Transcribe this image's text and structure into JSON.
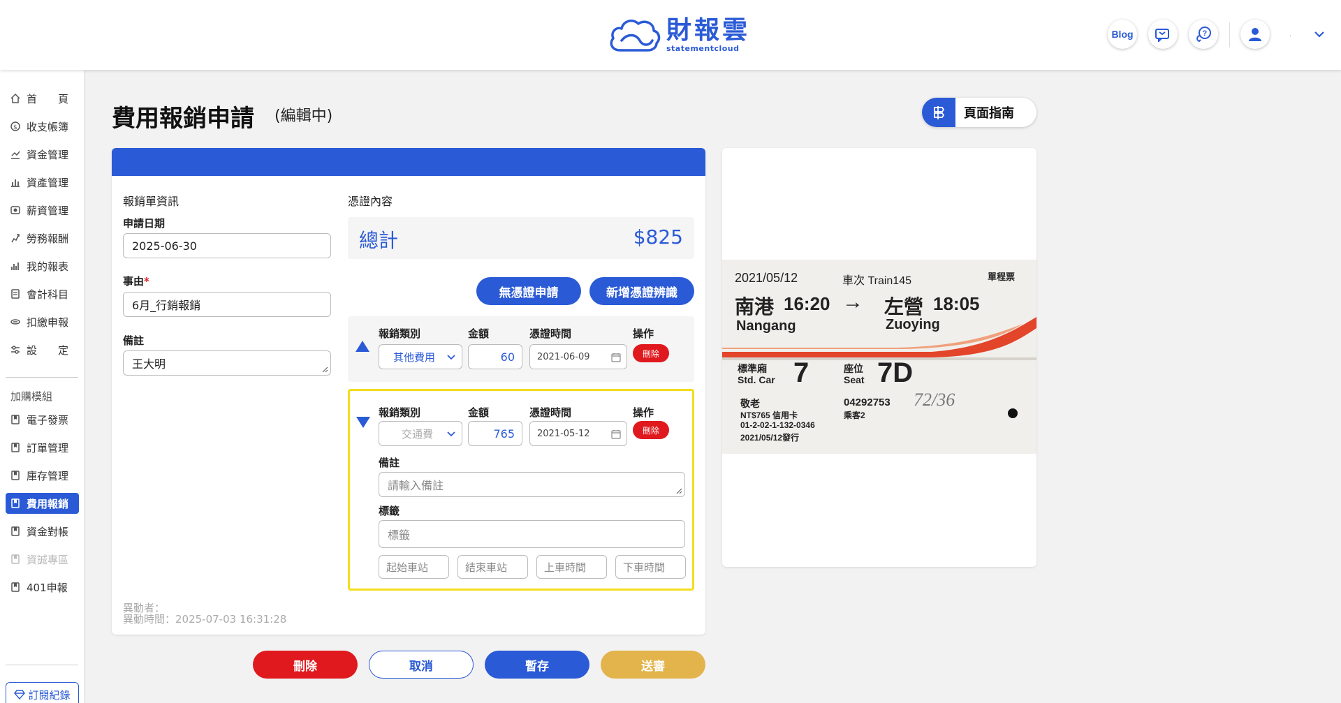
{
  "app": {
    "brand_name": "財報雲",
    "brand_sub": "statementcloud",
    "blog_label": "Blog",
    "user_dot": "·"
  },
  "sidebar": {
    "items": [
      {
        "label": "首　　頁",
        "icon": "home-icon"
      },
      {
        "label": "收支帳簿",
        "icon": "coin-icon"
      },
      {
        "label": "資金管理",
        "icon": "funds-icon"
      },
      {
        "label": "資產管理",
        "icon": "assets-icon"
      },
      {
        "label": "薪資管理",
        "icon": "payroll-icon"
      },
      {
        "label": "勞務報酬",
        "icon": "labor-icon"
      },
      {
        "label": "我的報表",
        "icon": "report-icon"
      },
      {
        "label": "會計科目",
        "icon": "ledger-icon"
      },
      {
        "label": "扣繳申報",
        "icon": "tax-icon"
      },
      {
        "label": "設　　定",
        "icon": "settings-icon"
      }
    ],
    "group_label": "加購模組",
    "modules": [
      {
        "label": "電子發票",
        "state": "normal"
      },
      {
        "label": "訂單管理",
        "state": "normal"
      },
      {
        "label": "庫存管理",
        "state": "normal"
      },
      {
        "label": "費用報銷",
        "state": "active"
      },
      {
        "label": "資金對帳",
        "state": "normal"
      },
      {
        "label": "資誠專區",
        "state": "disabled"
      },
      {
        "label": "401申報",
        "state": "normal"
      }
    ],
    "subscription_label": "訂閱紀錄"
  },
  "page": {
    "title": "費用報銷申請",
    "status": "(編輯中)",
    "guide_label": "頁面指南"
  },
  "form": {
    "section_title": "報銷單資訊",
    "date_label": "申請日期",
    "date_value": "2025-06-30",
    "reason_label": "事由",
    "reason_required": "*",
    "reason_value": "6月_行銷報銷",
    "note_label": "備註",
    "note_value": "王大明"
  },
  "voucher_section": {
    "title": "憑證內容",
    "total_label": "總計",
    "total_value": "$825",
    "no_voucher_button": "無憑證申請",
    "add_voucher_button": "新增憑證辨識"
  },
  "voucher_headers": {
    "type": "報銷類別",
    "amount": "金額",
    "time": "憑證時間",
    "action": "操作"
  },
  "vouchers": [
    {
      "type": "其他費用",
      "amount": "60",
      "date": "2021-06-09",
      "delete": "刪除",
      "expanded": false
    },
    {
      "type": "交通費",
      "amount": "765",
      "date": "2021-05-12",
      "delete": "刪除",
      "expanded": true,
      "note_label": "備註",
      "note_placeholder": "請輸入備註",
      "tag_label": "標籤",
      "tag_placeholder": "標籤",
      "fields": [
        "起始車站",
        "結束車站",
        "上車時間",
        "下車時間"
      ]
    }
  ],
  "audit": {
    "changed_by": "異動者：",
    "changed_at": "異動時間：2025-07-03 16:31:28"
  },
  "actions": {
    "delete": "刪除",
    "cancel": "取消",
    "save": "暫存",
    "submit": "送審"
  },
  "ticket": {
    "date": "2021/05/12",
    "train": "車次 Train145",
    "kind": "單程票",
    "from_zh": "南港",
    "depart": "16:20",
    "arrow": "→",
    "to_zh": "左營",
    "arrive": "18:05",
    "from_en": "Nangang",
    "to_en": "Zuoying",
    "car_zh": "標準廂",
    "car_en": "Std. Car",
    "car_no": "7",
    "seat_zh": "座位",
    "seat_en": "Seat",
    "seat_no": "7D",
    "passenger": "敬老",
    "price": "NT$765 信用卡",
    "code": "01-2-02-1-132-0346",
    "issued": "2021/05/12發行",
    "serial": "04292753",
    "pax": "乘客2",
    "handwriting": "72/36"
  },
  "colors": {
    "primary": "#2a5ad6",
    "danger": "#e0191e",
    "submit": "#e3b44b",
    "highlight": "#f2de1d"
  }
}
